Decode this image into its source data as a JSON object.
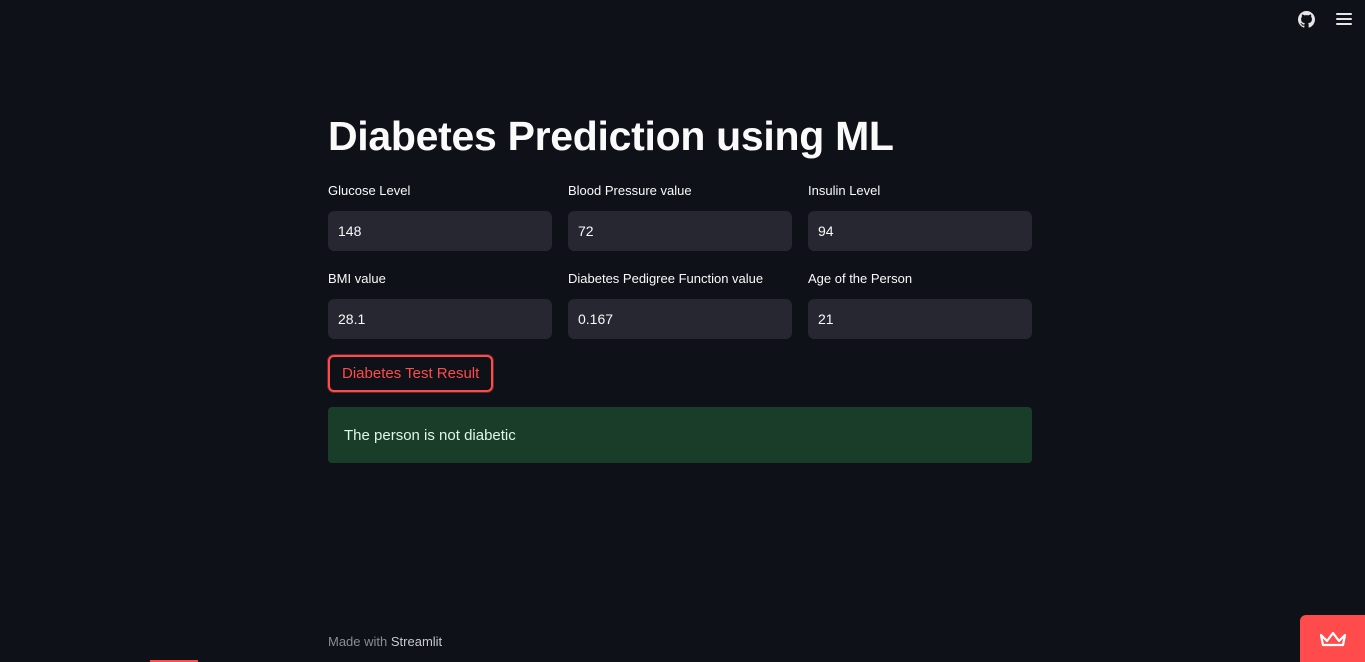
{
  "header": {
    "icons": [
      "github-icon",
      "hamburger-menu-icon"
    ]
  },
  "main": {
    "title": "Diabetes Prediction using ML",
    "fields": [
      {
        "label": "Glucose Level",
        "value": "148"
      },
      {
        "label": "Blood Pressure value",
        "value": "72"
      },
      {
        "label": "Insulin Level",
        "value": "94"
      },
      {
        "label": "BMI value",
        "value": "28.1"
      },
      {
        "label": "Diabetes Pedigree Function value",
        "value": "0.167"
      },
      {
        "label": "Age of the Person",
        "value": "21"
      }
    ],
    "button_label": "Diabetes Test Result",
    "result_message": "The person is not diabetic"
  },
  "footer": {
    "prefix": "Made with",
    "brand": "Streamlit"
  },
  "colors": {
    "background": "#0e1117",
    "accent": "#ff4b4b",
    "input_bg": "#262730",
    "success_bg": "#1a3d2a"
  }
}
